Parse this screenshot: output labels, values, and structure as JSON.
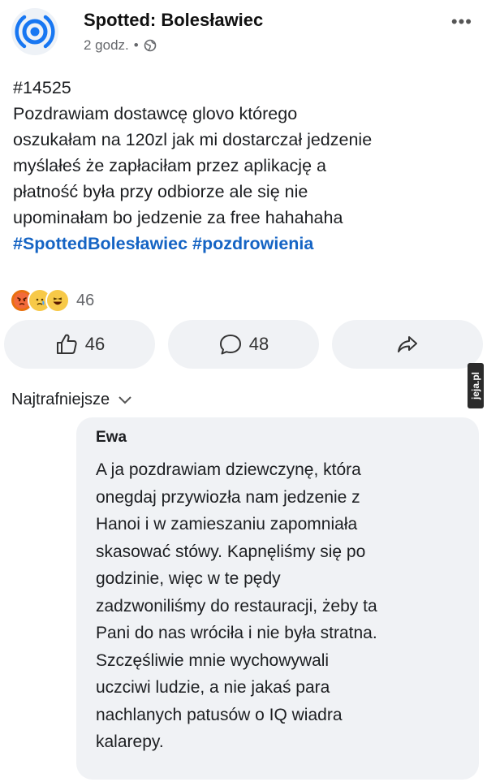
{
  "post": {
    "page_name": "Spotted: Bolesławiec",
    "time": "2 godz.",
    "separator": "•",
    "more_label": "•••",
    "text_lines": [
      "#14525",
      "Pozdrawiam dostawcę glovo którego",
      "oszukałam na 120zl jak mi dostarczał jedzenie",
      "myślałeś że zapłaciłam przez aplikację a",
      "płatność była przy odbiorze ale się nie",
      "upominałam bo jedzenie za free hahahaha"
    ],
    "hashtags": "#SpottedBolesławiec #pozdrowienia"
  },
  "reactions": {
    "emojis": [
      "angry-emoji",
      "sad-emoji",
      "haha-emoji"
    ],
    "count": "46"
  },
  "actions": {
    "like_count": "46",
    "comment_count": "48"
  },
  "comments_header": {
    "sort_label": "Najtrafniejsze"
  },
  "watermark": "jeja.pl",
  "comment": {
    "author": "Ewa",
    "text_lines": [
      "A ja pozdrawiam dziewczynę, która",
      "onegdaj przywiozła nam jedzenie z",
      "Hanoi i w zamieszaniu zapomniała",
      "skasować stówy. Kapnęliśmy się po",
      "godzinie, więc w te pędy",
      "zadzwoniliśmy do restauracji, żeby ta",
      "Pani do nas wróciła i nie była stratna.",
      "Szczęśliwie mnie wychowywali",
      "uczciwi ludzie, a nie jakaś para",
      "nachlanych patusów o IQ wiadra",
      "kalarepy."
    ]
  },
  "colors": {
    "hashtag": "#1564c4",
    "logo_blue": "#1877f2",
    "button_bg": "#f0f2f5",
    "comment_bg": "#f0f2f5"
  }
}
